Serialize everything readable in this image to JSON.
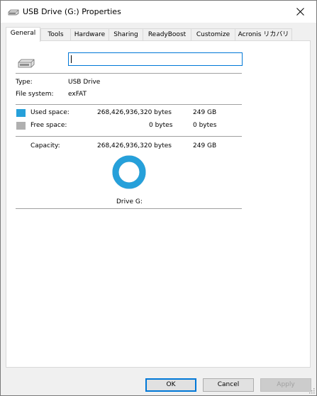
{
  "window": {
    "title": "USB Drive (G:) Properties",
    "accent_color": "#0078d7"
  },
  "tabs": [
    {
      "label": "General"
    },
    {
      "label": "Tools"
    },
    {
      "label": "Hardware"
    },
    {
      "label": "Sharing"
    },
    {
      "label": "ReadyBoost"
    },
    {
      "label": "Customize"
    },
    {
      "label": "Acronis リカバリ"
    }
  ],
  "general": {
    "name_value": "",
    "type_label": "Type:",
    "type_value": "USB Drive",
    "fs_label": "File system:",
    "fs_value": "exFAT",
    "used_label": "Used space:",
    "used_bytes": "268,426,936,320 bytes",
    "used_size": "249 GB",
    "used_color": "#26a0da",
    "free_label": "Free space:",
    "free_bytes": "0 bytes",
    "free_size": "0 bytes",
    "free_color": "#b0b0b0",
    "capacity_label": "Capacity:",
    "capacity_bytes": "268,426,936,320 bytes",
    "capacity_size": "249 GB",
    "used_fraction": 1.0,
    "drive_label": "Drive G:"
  },
  "buttons": {
    "ok": "OK",
    "cancel": "Cancel",
    "apply": "Apply"
  }
}
